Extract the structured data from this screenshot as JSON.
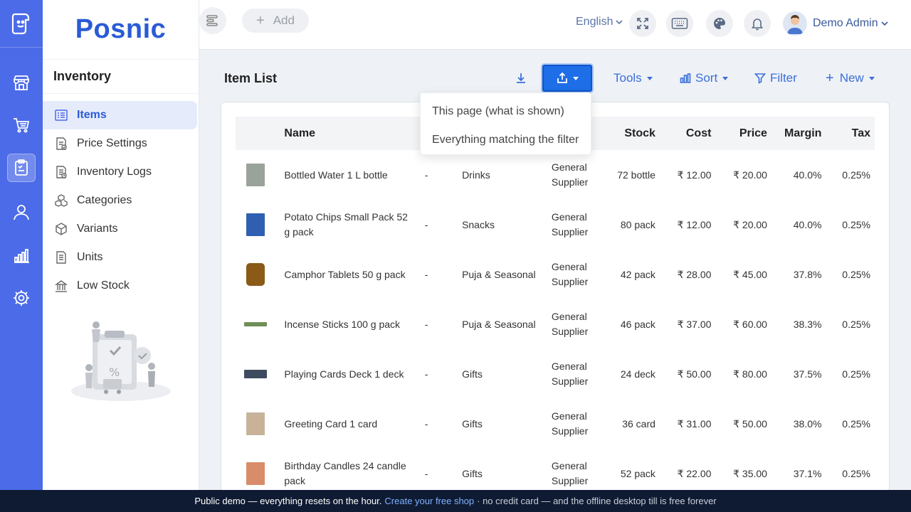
{
  "brand": {
    "name": "Posnic"
  },
  "sidebar": {
    "section": "Inventory",
    "items": [
      {
        "label": "Items",
        "icon": "items-icon",
        "active": true
      },
      {
        "label": "Price Settings",
        "icon": "price-settings-icon"
      },
      {
        "label": "Inventory Logs",
        "icon": "inventory-logs-icon"
      },
      {
        "label": "Categories",
        "icon": "categories-icon"
      },
      {
        "label": "Variants",
        "icon": "variants-icon"
      },
      {
        "label": "Units",
        "icon": "units-icon"
      },
      {
        "label": "Low Stock",
        "icon": "low-stock-icon"
      }
    ]
  },
  "topbar": {
    "add_label": "Add",
    "language": "English",
    "user_name": "Demo Admin"
  },
  "main": {
    "title": "Item List",
    "actions": {
      "tools": "Tools",
      "sort": "Sort",
      "filter": "Filter",
      "new": "New"
    },
    "export_menu": {
      "options": [
        "This page (what is shown)",
        "Everything matching the filter"
      ]
    }
  },
  "table": {
    "columns": [
      "",
      "Name",
      "",
      "",
      "",
      "Stock",
      "Cost",
      "Price",
      "Margin",
      "Tax"
    ],
    "rows": [
      {
        "name": "Bottled Water 1 L bottle",
        "sku": "-",
        "category": "Drinks",
        "supplier": "General Supplier",
        "stock": "72 bottle",
        "cost": "₹ 12.00",
        "price": "₹ 20.00",
        "margin": "40.0%",
        "tax": "0.25%",
        "thumb_color": "#9aa39a"
      },
      {
        "name": "Potato Chips Small Pack 52 g pack",
        "sku": "-",
        "category": "Snacks",
        "supplier": "General Supplier",
        "stock": "80 pack",
        "cost": "₹ 12.00",
        "price": "₹ 20.00",
        "margin": "40.0%",
        "tax": "0.25%",
        "thumb_color": "#2f5fb0"
      },
      {
        "name": "Camphor Tablets 50 g pack",
        "sku": "-",
        "category": "Puja & Seasonal",
        "supplier": "General Supplier",
        "stock": "42 pack",
        "cost": "₹ 28.00",
        "price": "₹ 45.00",
        "margin": "37.8%",
        "tax": "0.25%",
        "thumb_color": "#8a5a16"
      },
      {
        "name": "Incense Sticks 100 g pack",
        "sku": "-",
        "category": "Puja & Seasonal",
        "supplier": "General Supplier",
        "stock": "46 pack",
        "cost": "₹ 37.00",
        "price": "₹ 60.00",
        "margin": "38.3%",
        "tax": "0.25%",
        "thumb_color": "#6f8f55"
      },
      {
        "name": "Playing Cards Deck 1 deck",
        "sku": "-",
        "category": "Gifts",
        "supplier": "General Supplier",
        "stock": "24 deck",
        "cost": "₹ 50.00",
        "price": "₹ 80.00",
        "margin": "37.5%",
        "tax": "0.25%",
        "thumb_color": "#3d4b5e"
      },
      {
        "name": "Greeting Card 1 card",
        "sku": "-",
        "category": "Gifts",
        "supplier": "General Supplier",
        "stock": "36 card",
        "cost": "₹ 31.00",
        "price": "₹ 50.00",
        "margin": "38.0%",
        "tax": "0.25%",
        "thumb_color": "#c8b39a"
      },
      {
        "name": "Birthday Candles 24 candle pack",
        "sku": "-",
        "category": "Gifts",
        "supplier": "General Supplier",
        "stock": "52 pack",
        "cost": "₹ 22.00",
        "price": "₹ 35.00",
        "margin": "37.1%",
        "tax": "0.25%",
        "thumb_color": "#d98c6a"
      }
    ]
  },
  "footer": {
    "text1": "Public demo — everything resets on the hour.",
    "link": "Create your free shop",
    "text2": "· no credit card — and the offline desktop till is free forever"
  },
  "colors": {
    "rail": "#4c6be8",
    "accent": "#2a5bd7",
    "export_button": "#1e6ee8",
    "footer": "#0f1b33"
  }
}
